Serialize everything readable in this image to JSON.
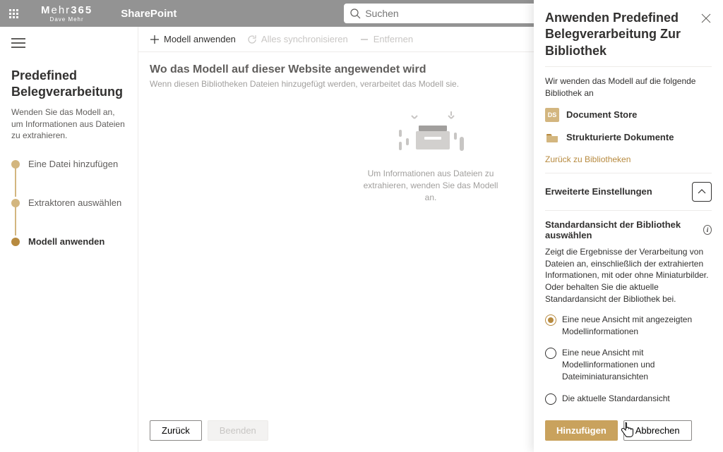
{
  "header": {
    "brand_main": "Mehr365",
    "brand_sub": "Dave Mehr",
    "app_name": "SharePoint",
    "search_placeholder": "Suchen"
  },
  "left": {
    "title": "Predefined Belegverarbeitung",
    "description": "Wenden Sie das Modell an, um Informationen aus Dateien zu extrahieren.",
    "steps": [
      "Eine Datei hinzufügen",
      "Extraktoren auswählen",
      "Modell anwenden"
    ]
  },
  "toolbar": {
    "apply": "Modell anwenden",
    "sync": "Alles synchronisieren",
    "remove": "Entfernen"
  },
  "main": {
    "title": "Wo das Modell auf dieser Website angewendet wird",
    "subtitle": "Wenn diesen Bibliotheken Dateien hinzugefügt werden, verarbeitet das Modell sie.",
    "empty_text": "Um Informationen aus Dateien zu extrahieren, wenden Sie das Modell an."
  },
  "footer": {
    "back": "Zurück",
    "finish": "Beenden"
  },
  "panel": {
    "title": "Anwenden Predefined Belegverarbeitung Zur Bibliothek",
    "apply_msg": "Wir wenden das Modell auf die folgende Bibliothek an",
    "lib1": "Document Store",
    "lib1_abbrev": "DS",
    "lib2": "Strukturierte Dokumente",
    "back_link": "Zurück zu Bibliotheken",
    "advanced": "Erweiterte Einstellungen",
    "view_label": "Standardansicht der Bibliothek auswählen",
    "view_desc": "Zeigt die Ergebnisse der Verarbeitung von Dateien an, einschließlich der extrahierten Informationen, mit oder ohne Miniaturbilder. Oder behalten Sie die aktuelle Standardansicht der Bibliothek bei.",
    "radio1": "Eine neue Ansicht mit angezeigten Modellinformationen",
    "radio2": "Eine neue Ansicht mit Modellinformationen und Dateiminiaturansichten",
    "radio3": "Die aktuelle Standardansicht",
    "add": "Hinzufügen",
    "cancel": "Abbrechen"
  }
}
